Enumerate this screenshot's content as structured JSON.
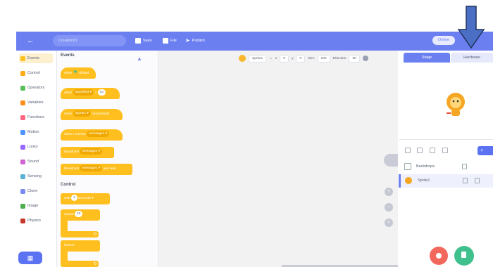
{
  "topbar": {
    "project_name": "Creation01",
    "save_label": "Save",
    "file_label": "File",
    "publish_label": "Publish",
    "online_label": "Online"
  },
  "categories": [
    {
      "label": "Events",
      "color": "#ffbf1f"
    },
    {
      "label": "Control",
      "color": "#ffab19"
    },
    {
      "label": "Operators",
      "color": "#59c059"
    },
    {
      "label": "Variables",
      "color": "#ff8c1a"
    },
    {
      "label": "Functions",
      "color": "#ff6680"
    },
    {
      "label": "Motion",
      "color": "#4c97ff"
    },
    {
      "label": "Looks",
      "color": "#9966ff"
    },
    {
      "label": "Sound",
      "color": "#cf63cf"
    },
    {
      "label": "Sensing",
      "color": "#5cb1d6"
    },
    {
      "label": "Clone",
      "color": "#7b8cf0"
    },
    {
      "label": "Image",
      "color": "#4cae4c"
    },
    {
      "label": "Physics",
      "color": "#c7392b"
    }
  ],
  "palette": {
    "events_title": "Events",
    "control_title": "Control",
    "blocks": {
      "when_flag": "when",
      "when_flag_suffix": "clicked",
      "when_key": "when",
      "when_key_pill": "Backfield ▾",
      "when_key_value": "10",
      "when_sprite": "when",
      "when_sprite_pill": "Sprite1 ▾",
      "when_sprite_suffix": "hat pressed",
      "when_receive": "when I receive",
      "when_receive_pill": "message1 ▾",
      "broadcast": "broadcast",
      "broadcast_pill": "message1 ▾",
      "broadcast_wait": "broadcast",
      "broadcast_wait_pill": "message1 ▾",
      "broadcast_wait_suffix": "and wait",
      "wait": "wait",
      "wait_value": "1",
      "wait_suffix": "seconds ▾",
      "repeat": "repeat",
      "repeat_value": "10",
      "forever": "forever"
    }
  },
  "spritebar": {
    "sprite_name": "Sprite1",
    "x_label": "x",
    "x_value": "0",
    "y_label": "y",
    "y_value": "0",
    "size_label": "Size",
    "size_value": "100",
    "direction_label": "Direction",
    "direction_value": "90"
  },
  "zoom": {
    "zoom_in": "+",
    "zoom_out": "−",
    "reset": "="
  },
  "right_panel": {
    "tab_stage": "Stage",
    "tab_hardware": "Hardware",
    "add_label": "+",
    "backdrops_label": "Backdrops",
    "sprite_label": "Sprite1"
  },
  "colors": {
    "accent": "#6b7ff0",
    "events": "#ffbf1f",
    "stop": "#f2685c",
    "go": "#3fc08c"
  },
  "icons": {
    "back": "arrow-left-icon",
    "save": "save-icon",
    "file": "folder-icon",
    "publish": "paper-plane-icon",
    "hardware_pointer": "down-arrow-icon"
  }
}
